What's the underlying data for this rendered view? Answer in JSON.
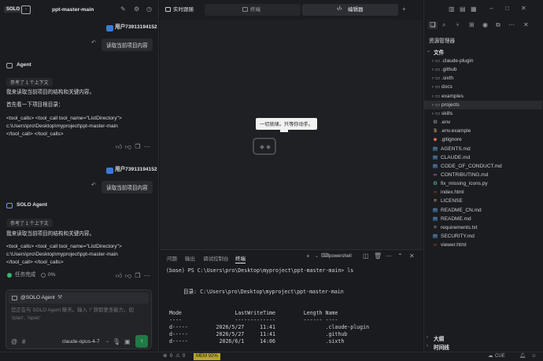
{
  "left": {
    "logo": "SOLO",
    "project": "ppt-master-main",
    "user1": "用户73913194152",
    "bubble1": "读取当前项目内容",
    "agent1_name": "Agent",
    "ref1": "参考了 1 个上下文",
    "a1_line1": "我来读取当前项目的结构和关键内容。",
    "a1_line2": "首先看一下项目根目录：",
    "a1_code1": "<tool_calls> <tool_call tool_name=\"ListDirectory\">",
    "a1_code2": "c:\\Users\\pro\\Desktop\\myproject\\ppt-master-main",
    "a1_code3": "</tool_call> </tool_calls>",
    "user2": "用户73913194152",
    "bubble2": "读取当前项目内容",
    "agent2_name": "SOLO Agent",
    "ref2": "参考了 1 个上下文",
    "a2_line1": "我来读取当前项目的结构和关键内容。",
    "a2_code1": "<tool_calls> <tool_call tool_name=\"ListDirectory\">",
    "a2_code2": "c:\\Users\\pro\\Desktop\\myproject\\ppt-master-main",
    "a2_code3": "</tool_call> </tool_calls>",
    "task_done": "任务完成",
    "progress": "0%",
    "agent_chip": "@SOLO Agent",
    "input_placeholder": "您正在与 SOLO Agent 聊天。输入 '/' 获取更多能力，如 '/plan', '/spec'",
    "model": "claude-opus-4-7"
  },
  "center": {
    "tab_preview": "实时跟随",
    "tab_terminal": "终端",
    "tab_editor": "编辑器",
    "tooltip": "一切就绪。只等你动手。",
    "panel_tabs": [
      "问题",
      "输出",
      "调试控制台",
      "终端"
    ],
    "shell": "powershell",
    "term": {
      "prompt": "(base) PS C:\\Users\\pro\\Desktop\\myproject\\ppt-master-main> ls",
      "dir": "目录: C:\\Users\\pro\\Desktop\\myproject\\ppt-master-main",
      "header": "Mode                 LastWriteTime         Length Name",
      "sep": "----                 -------------         ------ ----",
      "row1": "d-----         2026/5/27     11:41                .claude-plugin",
      "row2": "d-----         2026/5/27     11:41                .github",
      "row3": "d-----          2026/6/1     14:06                .sixth"
    }
  },
  "right": {
    "title": "资源管理器",
    "section": "文件",
    "items": [
      {
        "name": ".claude-plugin",
        "type": "folder"
      },
      {
        "name": ".github",
        "type": "folder"
      },
      {
        "name": ".sixth",
        "type": "folder"
      },
      {
        "name": "docs",
        "type": "folder"
      },
      {
        "name": "examples",
        "type": "folder"
      },
      {
        "name": "projects",
        "type": "folder"
      },
      {
        "name": "skills",
        "type": "folder"
      },
      {
        "name": ".env",
        "type": "gear"
      },
      {
        "name": ".env.example",
        "type": "dollar"
      },
      {
        "name": ".gitignore",
        "type": "git"
      },
      {
        "name": "AGENTS.md",
        "type": "md"
      },
      {
        "name": "CLAUDE.md",
        "type": "md"
      },
      {
        "name": "CODE_OF_CONDUCT.md",
        "type": "md"
      },
      {
        "name": "CONTRIBUTING.md",
        "type": "contrib"
      },
      {
        "name": "fix_missing_icons.py",
        "type": "py"
      },
      {
        "name": "index.html",
        "type": "html"
      },
      {
        "name": "LICENSE",
        "type": "license"
      },
      {
        "name": "README_CN.md",
        "type": "md"
      },
      {
        "name": "README.md",
        "type": "md"
      },
      {
        "name": "requirements.txt",
        "type": "txt"
      },
      {
        "name": "SECURITY.md",
        "type": "md"
      },
      {
        "name": "viewer.html",
        "type": "html"
      }
    ],
    "outline": "大纲",
    "timeline": "时间线"
  },
  "status": {
    "errors": "0",
    "warnings": "0",
    "mem": "MEM 92%",
    "encoding": "CUE"
  }
}
